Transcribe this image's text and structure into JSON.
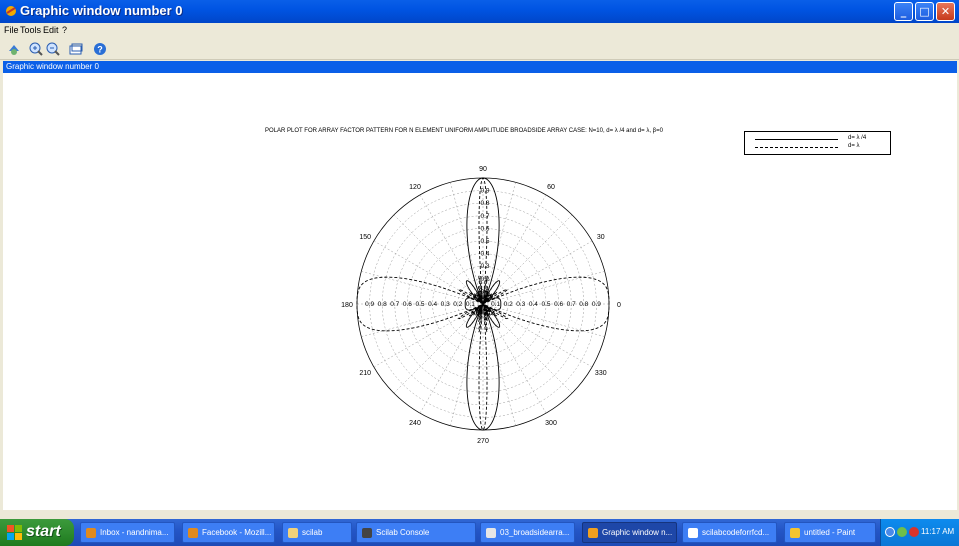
{
  "window": {
    "title": "Graphic window number 0",
    "menu": [
      "File",
      "Tools",
      "Edit",
      "?"
    ],
    "toolbar_icons": [
      "rotate-icon",
      "zoom-in-icon",
      "zoom-out-icon",
      "unzoom-icon",
      "help-icon"
    ],
    "figure_title": "Graphic window number 0"
  },
  "plot": {
    "title": "POLAR PLOT FOR ARRAY FACTOR PATTERN FOR N ELEMENT UNIFORM AMPLITUDE BROADSIDE ARRAY CASE: N=10, d= λ /4 and d= λ, β=0",
    "legend": [
      {
        "label": "d= λ /4",
        "style": "solid"
      },
      {
        "label": "d= λ",
        "style": "dashed"
      }
    ]
  },
  "chart_data": {
    "type": "polar",
    "title": "POLAR PLOT FOR ARRAY FACTOR PATTERN FOR N ELEMENT UNIFORM AMPLITUDE BROADSIDE ARRAY CASE: N=10, d= λ /4 and d= λ, β=0",
    "radial_ticks": [
      0.1,
      0.2,
      0.3,
      0.4,
      0.5,
      0.6,
      0.7,
      0.8,
      0.9
    ],
    "rlim": [
      0,
      1
    ],
    "angle_labels": [
      {
        "angle": 0,
        "text": "0"
      },
      {
        "angle": 30,
        "text": "30"
      },
      {
        "angle": 60,
        "text": "60"
      },
      {
        "angle": 90,
        "text": "90"
      },
      {
        "angle": 120,
        "text": "120"
      },
      {
        "angle": 150,
        "text": "150"
      },
      {
        "angle": 180,
        "text": "180"
      },
      {
        "angle": 210,
        "text": "210"
      },
      {
        "angle": 240,
        "text": "240"
      },
      {
        "angle": 270,
        "text": "270"
      },
      {
        "angle": 300,
        "text": "300"
      },
      {
        "angle": 330,
        "text": "330"
      }
    ],
    "series": [
      {
        "name": "d= λ /4",
        "style": "solid",
        "N": 10,
        "d_over_lambda": 0.25,
        "beta": 0
      },
      {
        "name": "d= λ",
        "style": "dashed",
        "N": 10,
        "d_over_lambda": 1.0,
        "beta": 0
      }
    ],
    "grid": true,
    "legend_position": "top-right"
  },
  "taskbar": {
    "start_label": "start",
    "tasks": [
      {
        "label": "Inbox - nandnima...",
        "color": "#e08a1e",
        "active": false
      },
      {
        "label": "Facebook - Mozill...",
        "color": "#e08a1e",
        "active": false
      },
      {
        "label": "scilab",
        "color": "#f2d27a",
        "active": false
      },
      {
        "label": "Scilab Console",
        "color": "#444444",
        "active": false
      },
      {
        "label": "03_broadsidearra...",
        "color": "#e6e6e6",
        "active": false
      },
      {
        "label": "Graphic window n...",
        "color": "#f0a020",
        "active": true
      },
      {
        "label": "scilabcodeforrfcd...",
        "color": "#ffffff",
        "active": false
      },
      {
        "label": "untitled - Paint",
        "color": "#f4c430",
        "active": false
      }
    ],
    "clock": "11:17 AM"
  }
}
